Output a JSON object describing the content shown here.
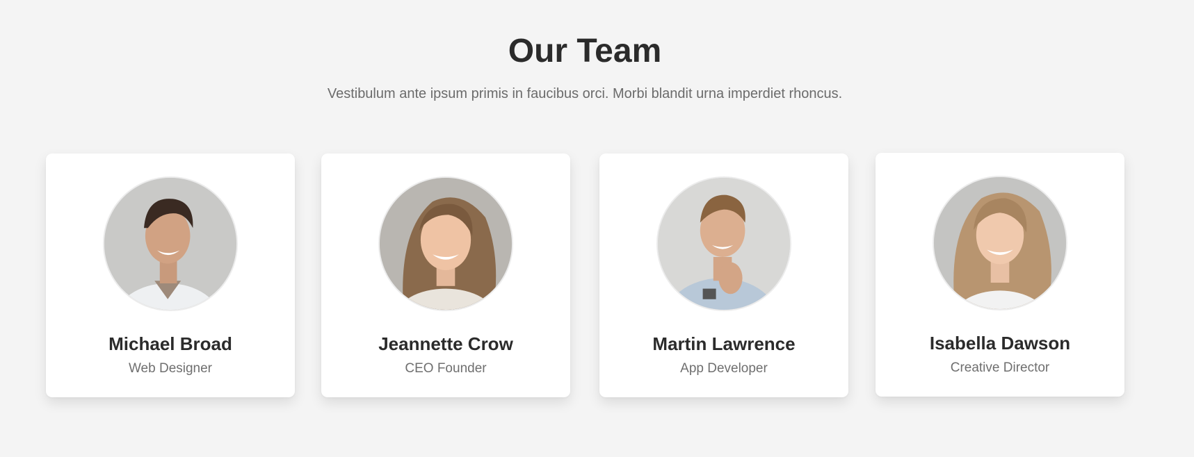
{
  "section": {
    "title": "Our Team",
    "subtitle": "Vestibulum ante ipsum primis in faucibus orci. Morbi blandit urna imperdiet rhoncus."
  },
  "members": [
    {
      "name": "Michael Broad",
      "role": "Web Designer"
    },
    {
      "name": "Jeannette Crow",
      "role": "CEO Founder"
    },
    {
      "name": "Martin Lawrence",
      "role": "App Developer"
    },
    {
      "name": "Isabella Dawson",
      "role": "Creative Director"
    }
  ],
  "colors": {
    "background": "#f4f4f4",
    "card": "#ffffff",
    "heading": "#2b2b2b",
    "muted": "#6b6b6b"
  }
}
